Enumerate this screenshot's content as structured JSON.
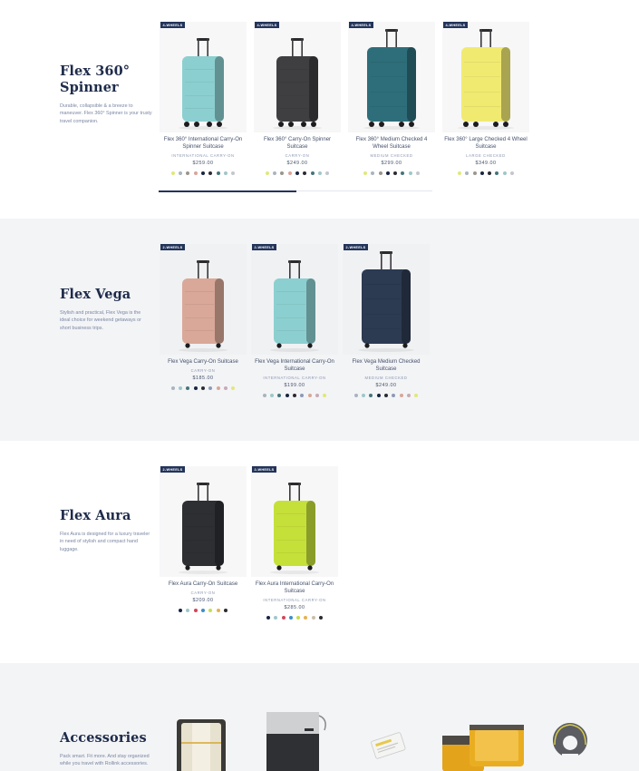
{
  "sections": [
    {
      "title_line1": "Flex 360°",
      "title_line2": "Spinner",
      "description": "Durable, collapsible & a breeze to maneuver. Flex 360° Spinner is your trusty travel companion.",
      "products": [
        {
          "badge": "4-WHEELS",
          "name": "Flex 360° International Carry-On Spinner Suitcase",
          "category": "INTERNATIONAL CARRY-ON",
          "price": "$259.00",
          "color": "#8ccfd0",
          "swatches": [
            "#e1e879",
            "#a9b4bf",
            "#9a968c",
            "#d9a697",
            "#17253f",
            "#2a2b30",
            "#45747a",
            "#9fc7c8",
            "#c3c7cc"
          ]
        },
        {
          "badge": "4-WHEELS",
          "name": "Flex 360° Carry-On Spinner Suitcase",
          "category": "CARRY-ON",
          "price": "$249.00",
          "color": "#3f3f42",
          "swatches": [
            "#e1e879",
            "#a9b4bf",
            "#9a968c",
            "#d9a697",
            "#17253f",
            "#2a2b30",
            "#45747a",
            "#9fc7c8",
            "#c3c7cc"
          ]
        },
        {
          "badge": "4-WHEELS",
          "name": "Flex 360° Medium Checked 4 Wheel Suitcase",
          "category": "MEDIUM CHECKED",
          "price": "$299.00",
          "color": "#2e6e7a",
          "swatches": [
            "#e1e879",
            "#a9b4bf",
            "#9a968c",
            "#17253f",
            "#2a2b30",
            "#45747a",
            "#9fc7c8",
            "#c3c7cc"
          ]
        },
        {
          "badge": "4-WHEELS",
          "name": "Flex 360° Large Checked 4 Wheel Suitcase",
          "category": "LARGE CHECKED",
          "price": "$349.00",
          "color": "#f1ea71",
          "swatches": [
            "#e1e879",
            "#a9b4bf",
            "#9a968c",
            "#17253f",
            "#2a2b30",
            "#45747a",
            "#9fc7c8",
            "#c3c7cc"
          ]
        }
      ]
    },
    {
      "title_line1": "Flex Vega",
      "title_line2": "",
      "description": "Stylish and practical, Flex Vega is the ideal choice for weekend getaways or short business trips.",
      "products": [
        {
          "badge": "2-WHEELS",
          "name": "Flex Vega Carry-On Suitcase",
          "category": "CARRY-ON",
          "price": "$185.00",
          "color": "#d9a898",
          "swatches": [
            "#a9b4bf",
            "#9fc7c8",
            "#45747a",
            "#17253f",
            "#2a2b30",
            "#8c9ab5",
            "#d9a697",
            "#c8a9b8",
            "#e1e879"
          ]
        },
        {
          "badge": "2-WHEELS",
          "name": "Flex Vega International Carry-On Suitcase",
          "category": "INTERNATIONAL CARRY-ON",
          "price": "$199.00",
          "color": "#8ccfd0",
          "swatches": [
            "#a9b4bf",
            "#9fc7c8",
            "#45747a",
            "#17253f",
            "#2a2b30",
            "#8c9ab5",
            "#d9a697",
            "#c8a9b8",
            "#e1e879"
          ]
        },
        {
          "badge": "2-WHEELS",
          "name": "Flex Vega Medium Checked Suitcase",
          "category": "MEDIUM CHECKED",
          "price": "$249.00",
          "color": "#2c3a52",
          "swatches": [
            "#a9b4bf",
            "#9fc7c8",
            "#45747a",
            "#17253f",
            "#2a2b30",
            "#8c9ab5",
            "#d9a697",
            "#c8a9b8",
            "#e1e879"
          ]
        }
      ]
    },
    {
      "title_line1": "Flex Aura",
      "title_line2": "",
      "description": "Flex Aura is designed for a luxury traveler in need of stylish and compact hand luggage.",
      "products": [
        {
          "badge": "2-WHEELS",
          "name": "Flex Aura Carry-On Suitcase",
          "category": "CARRY-ON",
          "price": "$209.00",
          "color": "#2e2f33",
          "swatches": [
            "#17253f",
            "#9fc7c8",
            "#d2465b",
            "#3d8ec9",
            "#c7de4a",
            "#e6b24b",
            "#2a2b30"
          ]
        },
        {
          "badge": "2-WHEELS",
          "name": "Flex Aura International Carry-On Suitcase",
          "category": "INTERNATIONAL CARRY-ON",
          "price": "$285.00",
          "color": "#c6e03a",
          "swatches": [
            "#17253f",
            "#9fc7c8",
            "#d2465b",
            "#3d8ec9",
            "#c7de4a",
            "#e6b24b",
            "#c9c0a8",
            "#2a2b30"
          ]
        }
      ]
    },
    {
      "title_line1": "Accessories",
      "title_line2": "",
      "description": "Pack smart. Fit more. And stay organized while you travel with Rollink accessories."
    }
  ]
}
